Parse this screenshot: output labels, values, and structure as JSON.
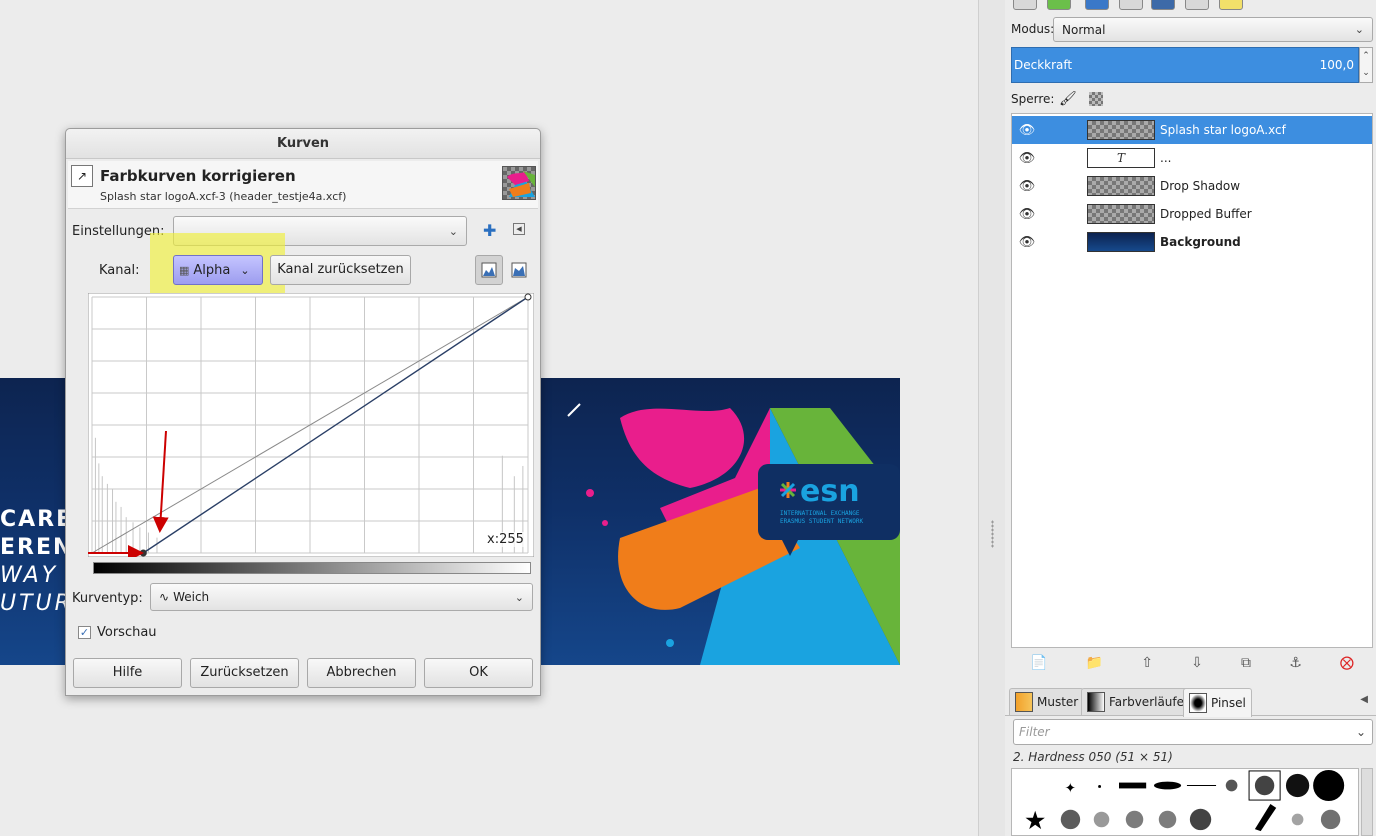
{
  "canvas": {
    "banner_lines": [
      "CARE",
      "EREN",
      "WAY",
      "UTUR"
    ],
    "logo_text": "esn",
    "logo_sub1": "INTERNATIONAL EXCHANGE",
    "logo_sub2": "ERASMUS STUDENT NETWORK"
  },
  "layers_panel": {
    "mode_label": "Modus:",
    "mode_value": "Normal",
    "opacity_label": "Deckkraft",
    "opacity_value": "100,0",
    "lock_label": "Sperre:",
    "layers": [
      {
        "name": "Splash star logoA.xcf",
        "selected": true
      },
      {
        "name": "...",
        "selected": false
      },
      {
        "name": "Drop Shadow",
        "selected": false
      },
      {
        "name": "Dropped Buffer",
        "selected": false
      },
      {
        "name": "Background",
        "selected": false
      }
    ]
  },
  "brushes_panel": {
    "tabs": [
      "Muster",
      "Farbverläufe",
      "Pinsel"
    ],
    "filter_placeholder": "Filter",
    "brush_name": "2. Hardness 050 (51 × 51)"
  },
  "dialog": {
    "window_title": "Kurven",
    "header_title": "Farbkurven korrigieren",
    "header_subtitle": "Splash star logoA.xcf-3 (header_testje4a.xcf)",
    "presets_label": "Einstellungen:",
    "presets_value": "",
    "channel_label": "Kanal:",
    "channel_value": "Alpha",
    "reset_channel_label": "Kanal zurücksetzen",
    "x_readout": "x:255",
    "curve_type_label": "Kurventyp:",
    "curve_type_value": "Weich",
    "preview_label": "Vorschau",
    "preview_checked": true,
    "buttons": {
      "help": "Hilfe",
      "reset": "Zurücksetzen",
      "cancel": "Abbrechen",
      "ok": "OK"
    }
  },
  "curve_data": {
    "channel": "Alpha",
    "input_range": [
      0,
      255
    ],
    "active_curve_points": [
      [
        30,
        0
      ],
      [
        255,
        255
      ]
    ],
    "reference_curve_points": [
      [
        0,
        0
      ],
      [
        255,
        255
      ]
    ]
  },
  "colors": {
    "highlight": "#f0f032",
    "selection": "#3d8ee0",
    "arrow": "#cc0000"
  }
}
